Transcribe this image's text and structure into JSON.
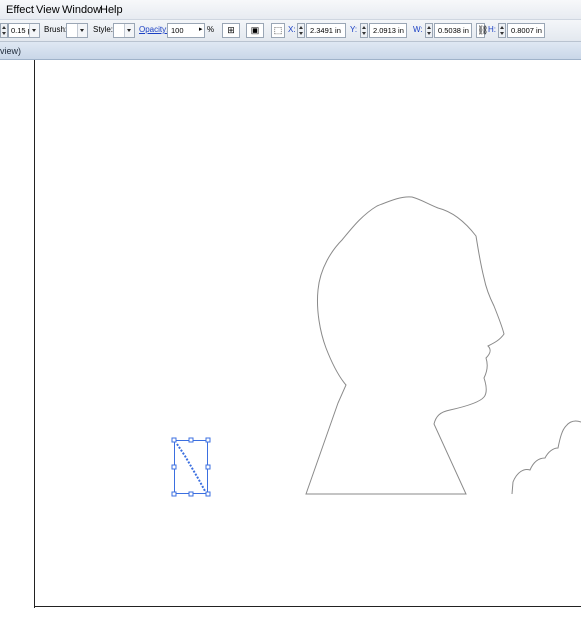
{
  "menubar": {
    "items": [
      "Effect",
      "View",
      "Window",
      "Help"
    ]
  },
  "toolbar": {
    "stroke_weight": "0.15 p",
    "brush_label": "Brush:",
    "style_label": "Style:",
    "opacity_label": "Opacity:",
    "opacity_value": "100",
    "percent_sign": "%",
    "x_label": "X:",
    "x_value": "2.3491 in",
    "y_label": "Y:",
    "y_value": "2.0913 in",
    "w_label": "W:",
    "w_value": "0.5038 in",
    "h_label": "H:",
    "h_value": "0.8007 in"
  },
  "document_tab": {
    "label": "view)"
  },
  "icons": {
    "align": "align-icon",
    "transform": "transform-icon",
    "link": "link-icon"
  },
  "colors": {
    "selection": "#3b6fe0",
    "artboard_edge": "#222222",
    "silhouette_stroke": "#8a8a8a"
  }
}
